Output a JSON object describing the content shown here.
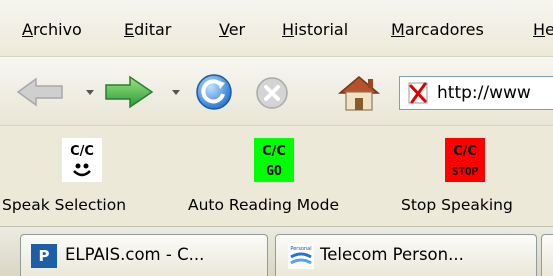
{
  "menubar": {
    "items": [
      {
        "first": "A",
        "rest": "rchivo"
      },
      {
        "first": "E",
        "rest": "ditar"
      },
      {
        "first": "V",
        "rest": "er"
      },
      {
        "first": "H",
        "rest": "istorial"
      },
      {
        "first": "M",
        "rest": "arcadores"
      },
      {
        "first": "H",
        "rest": "e"
      }
    ]
  },
  "navbar": {
    "url": "http://www"
  },
  "speakbar": {
    "buttons": [
      {
        "label": "Speak Selection",
        "icon_text": "C/C",
        "icon_bg": "#ffffff"
      },
      {
        "label": "Auto Reading Mode",
        "icon_text": "C/C",
        "badge": "GO",
        "icon_bg": "#00ff00"
      },
      {
        "label": "Stop Speaking",
        "icon_text": "C/C",
        "badge": "STOP",
        "icon_bg": "#ff0000"
      }
    ]
  },
  "tabs": [
    {
      "label": "ELPAIS.com - C...",
      "favicon_text": "P"
    },
    {
      "label": "Telecom Person...",
      "favicon_text": "Personal"
    }
  ],
  "colors": {
    "chrome": "#ece9d8",
    "back_arrow": "#c8c8c8",
    "forward_arrow": "#3cb34a",
    "reload": "#2f7fd6",
    "stop": "#c9c9c9",
    "home_roof": "#b5522b"
  }
}
